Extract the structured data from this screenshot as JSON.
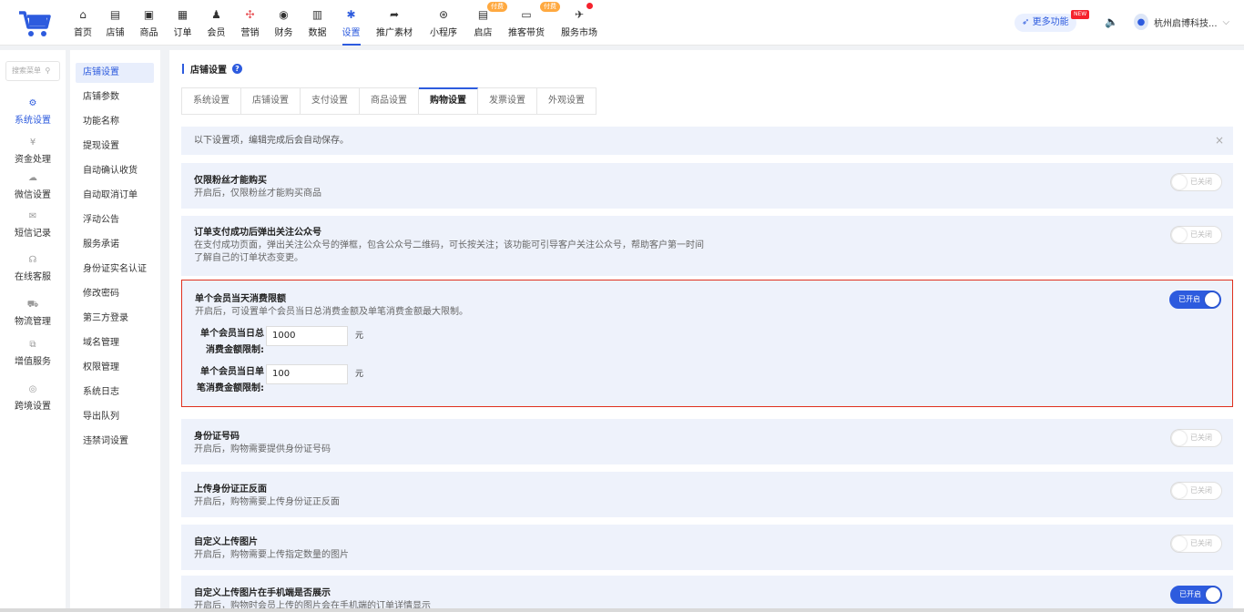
{
  "nav": [
    {
      "label": "首页",
      "icon": "home-icon"
    },
    {
      "label": "店铺",
      "icon": "store-icon"
    },
    {
      "label": "商品",
      "icon": "goods-icon"
    },
    {
      "label": "订单",
      "icon": "order-icon"
    },
    {
      "label": "会员",
      "icon": "member-icon"
    },
    {
      "label": "营销",
      "icon": "marketing-icon"
    },
    {
      "label": "财务",
      "icon": "finance-icon"
    },
    {
      "label": "数据",
      "icon": "data-icon"
    },
    {
      "label": "设置",
      "icon": "settings-icon"
    },
    {
      "label": "推广素材",
      "icon": "share-icon"
    },
    {
      "label": "小程序",
      "icon": "miniprogram-icon"
    },
    {
      "label": "启店",
      "icon": "launch-store-icon",
      "badge": "付费"
    },
    {
      "label": "推客带货",
      "icon": "promoter-icon",
      "badge": "付费"
    },
    {
      "label": "服务市场",
      "icon": "service-market-icon"
    }
  ],
  "header": {
    "more_features": "更多功能",
    "new_tag": "NEW",
    "account_name": "杭州启博科技..."
  },
  "side1": {
    "search_placeholder": "搜索菜单",
    "items": [
      {
        "label": "系统设置",
        "icon": "gear-icon"
      },
      {
        "label": "资金处理",
        "icon": "yen-icon"
      },
      {
        "label": "微信设置",
        "icon": "wechat-icon"
      },
      {
        "label": "短信记录",
        "icon": "message-icon"
      },
      {
        "label": "在线客服",
        "icon": "headset-icon"
      },
      {
        "label": "物流管理",
        "icon": "truck-icon"
      },
      {
        "label": "增值服务",
        "icon": "chart-icon"
      },
      {
        "label": "跨境设置",
        "icon": "globe-icon"
      }
    ]
  },
  "side2": {
    "items": [
      "店铺设置",
      "店铺参数",
      "功能名称",
      "提现设置",
      "自动确认收货",
      "自动取消订单",
      "浮动公告",
      "服务承诺",
      "身份证实名认证",
      "修改密码",
      "第三方登录",
      "域名管理",
      "权限管理",
      "系统日志",
      "导出队列",
      "违禁词设置"
    ]
  },
  "main": {
    "title": "店铺设置",
    "tabs": [
      "系统设置",
      "店铺设置",
      "支付设置",
      "商品设置",
      "购物设置",
      "发票设置",
      "外观设置"
    ],
    "notice": "以下设置项，编辑完成后会自动保存。",
    "switch_off": "已关闭",
    "switch_on": "已开启",
    "rows": [
      {
        "title": "仅限粉丝才能购买",
        "desc": "开启后，仅限粉丝才能购买商品"
      },
      {
        "title": "订单支付成功后弹出关注公众号",
        "desc": "在支付成功页面，弹出关注公众号的弹框，包含公众号二维码，可长按关注；该功能可引导客户关注公众号，帮助客户第一时间了解自己的订单状态变更。"
      },
      {
        "title": "单个会员当天消费限额",
        "desc": "开启后，可设置单个会员当日总消费金额及单笔消费金额最大限制。"
      },
      {
        "title": "身份证号码",
        "desc": "开启后，购物需要提供身份证号码"
      },
      {
        "title": "上传身份证正反面",
        "desc": "开启后，购物需要上传身份证正反面"
      },
      {
        "title": "自定义上传图片",
        "desc": "开启后，购物需要上传指定数量的图片"
      },
      {
        "title": "自定义上传图片在手机端是否展示",
        "desc": "开启后，购物时会员上传的图片会在手机端的订单详情显示"
      }
    ],
    "limit_fields": [
      {
        "label": "单个会员当日总消费金额限制:",
        "value": "1000",
        "unit": "元"
      },
      {
        "label": "单个会员当日单笔消费金额限制:",
        "value": "100",
        "unit": "元"
      }
    ]
  }
}
